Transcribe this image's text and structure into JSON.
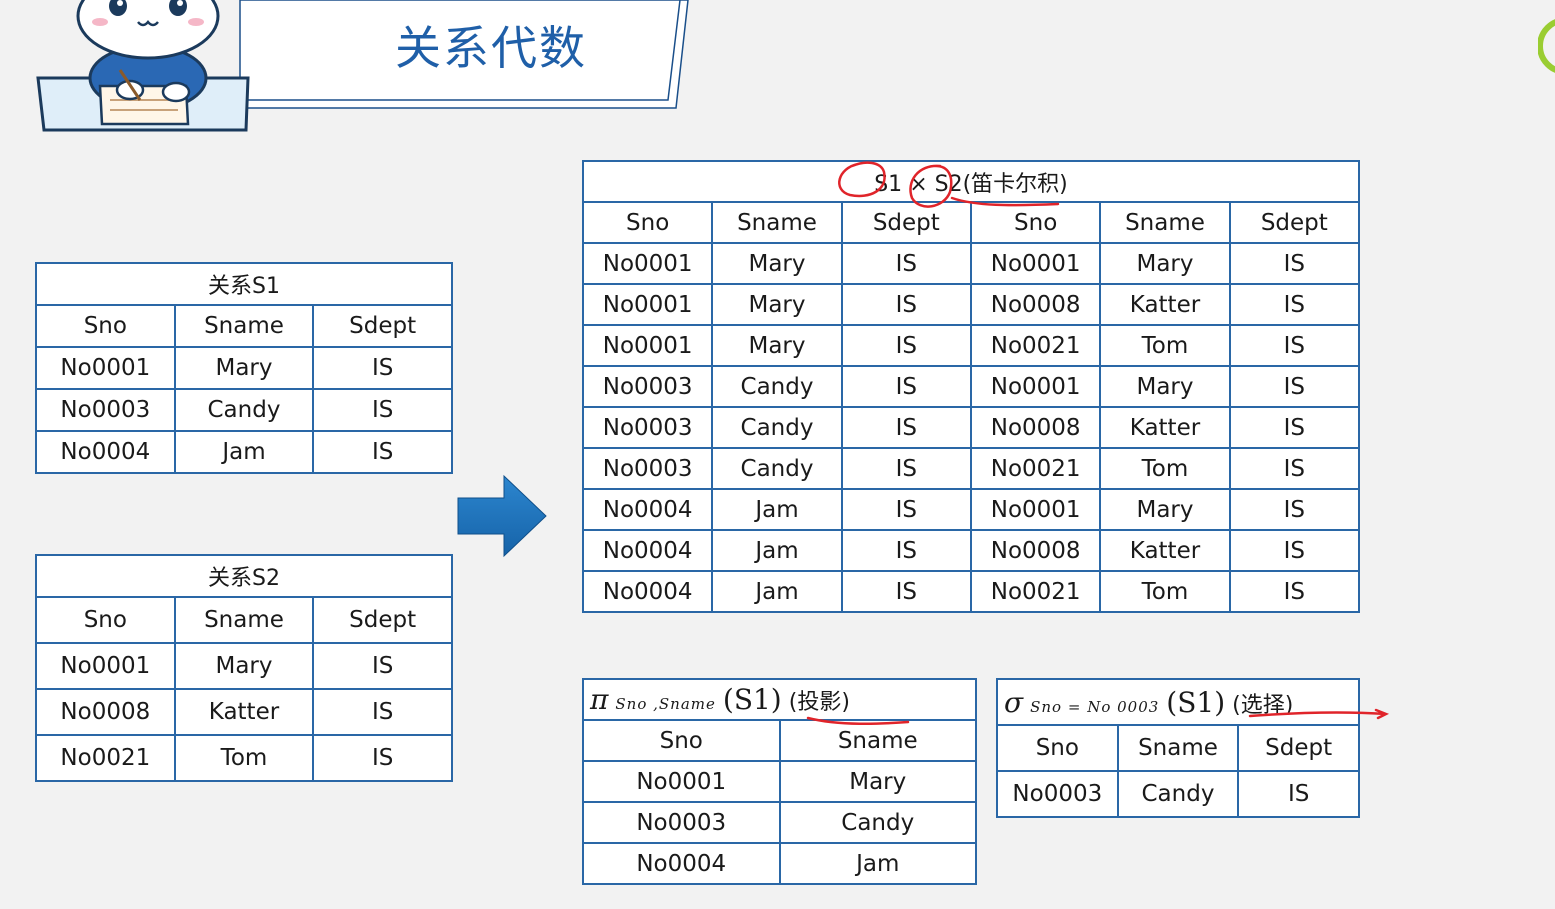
{
  "header": {
    "title": "关系代数"
  },
  "colors": {
    "table_border": "#2a67a6",
    "title_blue": "#1f5fa8",
    "arrow_blue": "#1d6fb5",
    "ink_red": "#e0242a",
    "background": "#f2f2f2"
  },
  "s1": {
    "caption": "关系S1",
    "columns": [
      "Sno",
      "Sname",
      "Sdept"
    ],
    "rows": [
      [
        "No0001",
        "Mary",
        "IS"
      ],
      [
        "No0003",
        "Candy",
        "IS"
      ],
      [
        "No0004",
        "Jam",
        "IS"
      ]
    ]
  },
  "s2": {
    "caption": "关系S2",
    "columns": [
      "Sno",
      "Sname",
      "Sdept"
    ],
    "rows": [
      [
        "No0001",
        "Mary",
        "IS"
      ],
      [
        "No0008",
        "Katter",
        "IS"
      ],
      [
        "No0021",
        "Tom",
        "IS"
      ]
    ]
  },
  "product": {
    "caption_a": "S1",
    "caption_op": "×",
    "caption_b": "S2",
    "caption_note": "(笛卡尔积)",
    "columns": [
      "Sno",
      "Sname",
      "Sdept",
      "Sno",
      "Sname",
      "Sdept"
    ],
    "rows": [
      [
        "No0001",
        "Mary",
        "IS",
        "No0001",
        "Mary",
        "IS"
      ],
      [
        "No0001",
        "Mary",
        "IS",
        "No0008",
        "Katter",
        "IS"
      ],
      [
        "No0001",
        "Mary",
        "IS",
        "No0021",
        "Tom",
        "IS"
      ],
      [
        "No0003",
        "Candy",
        "IS",
        "No0001",
        "Mary",
        "IS"
      ],
      [
        "No0003",
        "Candy",
        "IS",
        "No0008",
        "Katter",
        "IS"
      ],
      [
        "No0003",
        "Candy",
        "IS",
        "No0021",
        "Tom",
        "IS"
      ],
      [
        "No0004",
        "Jam",
        "IS",
        "No0001",
        "Mary",
        "IS"
      ],
      [
        "No0004",
        "Jam",
        "IS",
        "No0008",
        "Katter",
        "IS"
      ],
      [
        "No0004",
        "Jam",
        "IS",
        "No0021",
        "Tom",
        "IS"
      ]
    ]
  },
  "projection": {
    "symbol": "π",
    "subscript": "Sno ,Sname",
    "argument": "(S1)",
    "note": "(投影)",
    "columns": [
      "Sno",
      "Sname"
    ],
    "rows": [
      [
        "No0001",
        "Mary"
      ],
      [
        "No0003",
        "Candy"
      ],
      [
        "No0004",
        "Jam"
      ]
    ]
  },
  "selection": {
    "symbol": "σ",
    "subscript": "Sno = No 0003",
    "argument": "(S1)",
    "note": "(选择)",
    "columns": [
      "Sno",
      "Sname",
      "Sdept"
    ],
    "rows": [
      [
        "No0003",
        "Candy",
        "IS"
      ]
    ]
  }
}
